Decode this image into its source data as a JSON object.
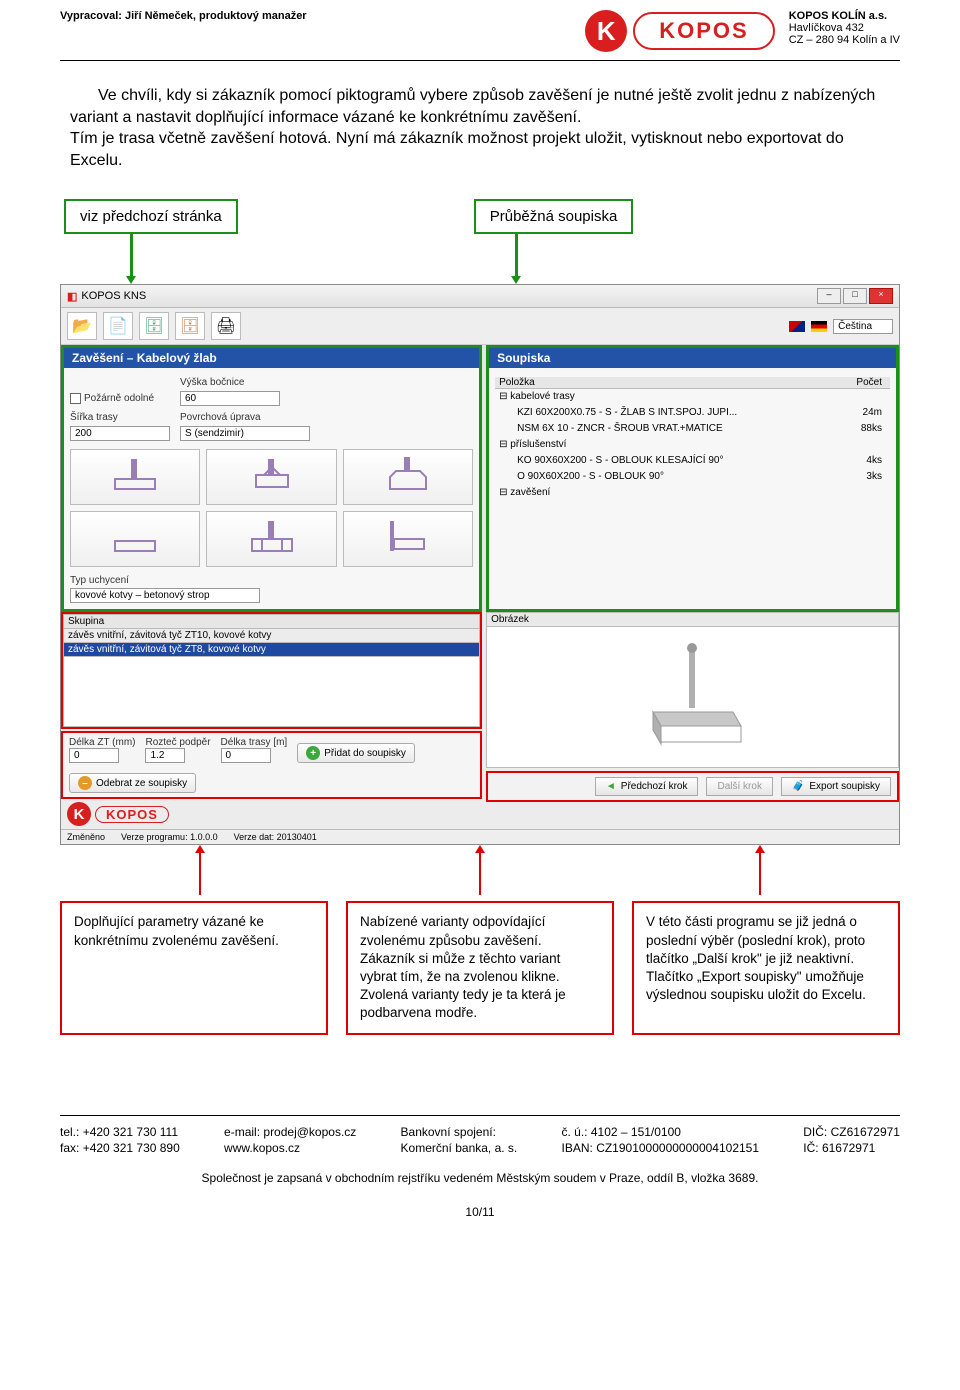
{
  "header": {
    "author": "Vypracoval: Jiří Němeček, produktový manažer",
    "company": "KOPOS KOLÍN a.s.",
    "addr1": "Havlíčkova 432",
    "addr2": "CZ – 280 94 Kolín a IV",
    "logoLetter": "K",
    "logoWord": "KOPOS"
  },
  "bodyPara": "Ve chvíli, kdy si zákazník pomocí piktogramů vybere způsob zavěšení je nutné ještě zvolit jednu z nabízených variant a nastavit doplňující informace vázané ke konkrétnímu zavěšení.\nTím je trasa včetně zavěšení hotová. Nyní má zákazník možnost projekt uložit, vytisknout nebo exportovat do Excelu.",
  "calloutGreen1": "viz předchozí stránka",
  "calloutGreen2": "Průběžná soupiska",
  "app": {
    "title": "KOPOS KNS",
    "toolbar": {
      "open": "📂",
      "new": "📄",
      "db1": "🗄",
      "db2": "🗄",
      "print": "🖨"
    },
    "langLabel": "Čeština",
    "leftPanel": {
      "title": "Zavěšení – Kabelový žlab",
      "fireLabel": "Požárně odolné",
      "fireChecked": false,
      "heightLbl": "Výška bočnice",
      "heightVal": "60",
      "widthLbl": "Šířka trasy",
      "widthVal": "200",
      "surfaceLbl": "Povrchová úprava",
      "surfaceVal": "S (sendzimir)",
      "typUchyLbl": "Typ uchycení",
      "typUchyVal": "kovové kotvy – betonový strop"
    },
    "rightPanel": {
      "title": "Soupiska",
      "col1": "Položka",
      "col2": "Počet",
      "items": [
        {
          "label": "kabelové trasy",
          "count": "",
          "root": true
        },
        {
          "label": "KZI 60X200X0.75 - S - ŽLAB S INT.SPOJ. JUPI...",
          "count": "24m"
        },
        {
          "label": "NSM 6X 10 - ZNCR - ŠROUB VRAT.+MATICE",
          "count": "88ks"
        },
        {
          "label": "příslušenství",
          "count": "",
          "root": true
        },
        {
          "label": "KO 90X60X200 - S - OBLOUK KLESAJÍCÍ 90°",
          "count": "4ks"
        },
        {
          "label": "O 90X60X200 - S - OBLOUK 90°",
          "count": "3ks"
        },
        {
          "label": "zavěšení",
          "count": "",
          "root": true
        }
      ]
    },
    "skupina": {
      "hdr": "Skupina",
      "row1": "závěs vnitřní, závitová tyč ZT10, kovové kotvy",
      "row2": "závěs vnitřní, závitová tyč ZT8, kovové kotvy"
    },
    "params": {
      "delkaLbl": "Délka ZT (mm)",
      "delkaVal": "0",
      "rozLbl": "Rozteč podpěr",
      "rozVal": "1.2",
      "trasaLbl": "Délka trasy [m]",
      "trasaVal": "0",
      "addBtn": "Přidat do soupisky",
      "remBtn": "Odebrat ze soupisky"
    },
    "obrazek": "Obrázek",
    "nav": {
      "prev": "Předchozí krok",
      "next": "Další krok",
      "export": "Export soupisky"
    },
    "statusbar": {
      "changed": "Změněno",
      "ver1lbl": "Verze programu:",
      "ver1": "1.0.0.0",
      "ver2lbl": "Verze dat:",
      "ver2": "20130401"
    }
  },
  "calloutsRed": {
    "c1": "Doplňující parametry vázané ke konkrétnímu zvolenému zavěšení.",
    "c2": "Nabízené varianty odpovídající zvolenému způsobu zavěšení. Zákazník si může z těchto variant vybrat tím, že na zvolenou klikne. Zvolená varianty tedy je ta která je podbarvena modře.",
    "c3": "V této části programu se již jedná o poslední výběr (poslední krok), proto tlačítko „Další krok\" je již neaktivní. Tlačítko „Export soupisky\" umožňuje výslednou soupisku uložit do Excelu."
  },
  "footer": {
    "telLbl": "tel.:",
    "tel": "+420 321 730 111",
    "faxLbl": "fax:",
    "fax": "+420 321 730 890",
    "emailLbl": "e-mail:",
    "email": "prodej@kopos.cz",
    "web": "www.kopos.cz",
    "bankLbl": "Bankovní spojení:",
    "bank": "Komerční banka, a. s.",
    "acctLbl": "č. ú.:",
    "acct": "4102 – 151/0100",
    "ibanLbl": "IBAN:",
    "iban": "CZ1901000000000004102151",
    "dicLbl": "DIČ:",
    "dic": "CZ61672971",
    "icLbl": "IČ:",
    "ic": "61672971",
    "registration": "Společnost je zapsaná v obchodním rejstříku vedeném Městským soudem v Praze, oddíl B, vložka 3689.",
    "pagenum": "10/11"
  }
}
